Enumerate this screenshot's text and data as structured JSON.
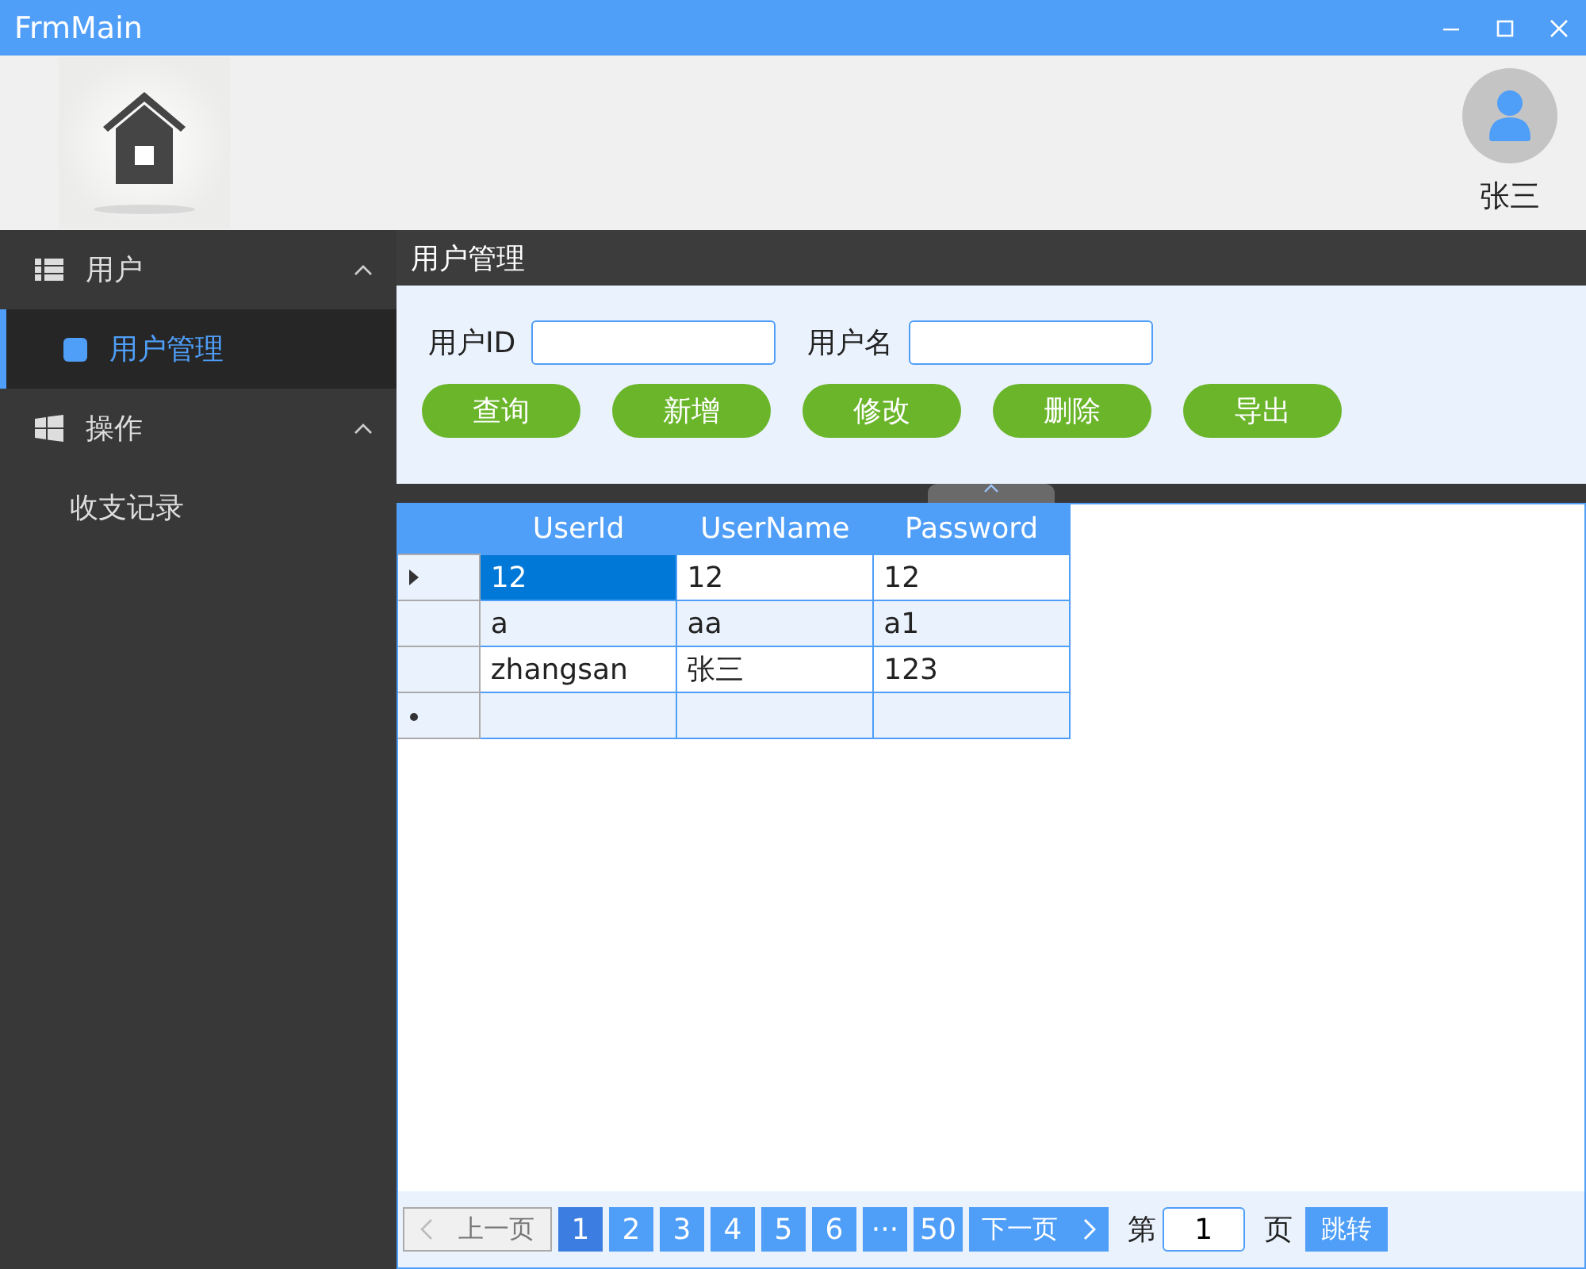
{
  "window": {
    "title": "FrmMain"
  },
  "header": {
    "user_name": "张三"
  },
  "sidebar": {
    "groups": [
      {
        "label": "用户",
        "kind": "list",
        "expanded": true,
        "children": [
          {
            "label": "用户管理",
            "selected": true,
            "icon": true
          }
        ]
      },
      {
        "label": "操作",
        "kind": "windows",
        "expanded": true,
        "children": [
          {
            "label": "收支记录",
            "selected": false,
            "icon": false
          }
        ]
      }
    ]
  },
  "page": {
    "title": "用户管理",
    "filters": [
      {
        "label": "用户ID"
      },
      {
        "label": "用户名"
      }
    ],
    "buttons": [
      "查询",
      "新增",
      "修改",
      "删除",
      "导出"
    ],
    "grid": {
      "columns": [
        "UserId",
        "UserName",
        "Password"
      ],
      "rows": [
        {
          "current": true,
          "cells": [
            {
              "text": "12",
              "selected": true
            },
            {
              "text": "12",
              "selected": false
            },
            {
              "text": "12",
              "selected": false
            }
          ]
        },
        {
          "current": false,
          "cells": [
            {
              "text": "a",
              "selected": false
            },
            {
              "text": "aa",
              "selected": false
            },
            {
              "text": "a1",
              "selected": false
            }
          ]
        },
        {
          "current": false,
          "cells": [
            {
              "text": "zhangsan",
              "selected": false
            },
            {
              "text": "张三",
              "selected": false
            },
            {
              "text": "123",
              "selected": false
            }
          ]
        }
      ],
      "new_row": true
    },
    "pager": {
      "prev": {
        "label": "上一页",
        "disabled": true
      },
      "pages": [
        {
          "label": "1",
          "selected": true
        },
        {
          "label": "2",
          "selected": false
        },
        {
          "label": "3",
          "selected": false
        },
        {
          "label": "4",
          "selected": false
        },
        {
          "label": "5",
          "selected": false
        },
        {
          "label": "6",
          "selected": false
        },
        {
          "label": "···",
          "selected": false
        },
        {
          "label": "50",
          "selected": false
        }
      ],
      "next": {
        "label": "下一页",
        "disabled": false
      },
      "goto_prefix": "第",
      "goto_value": "1",
      "goto_suffix": "页",
      "goto_button": "跳转"
    }
  }
}
